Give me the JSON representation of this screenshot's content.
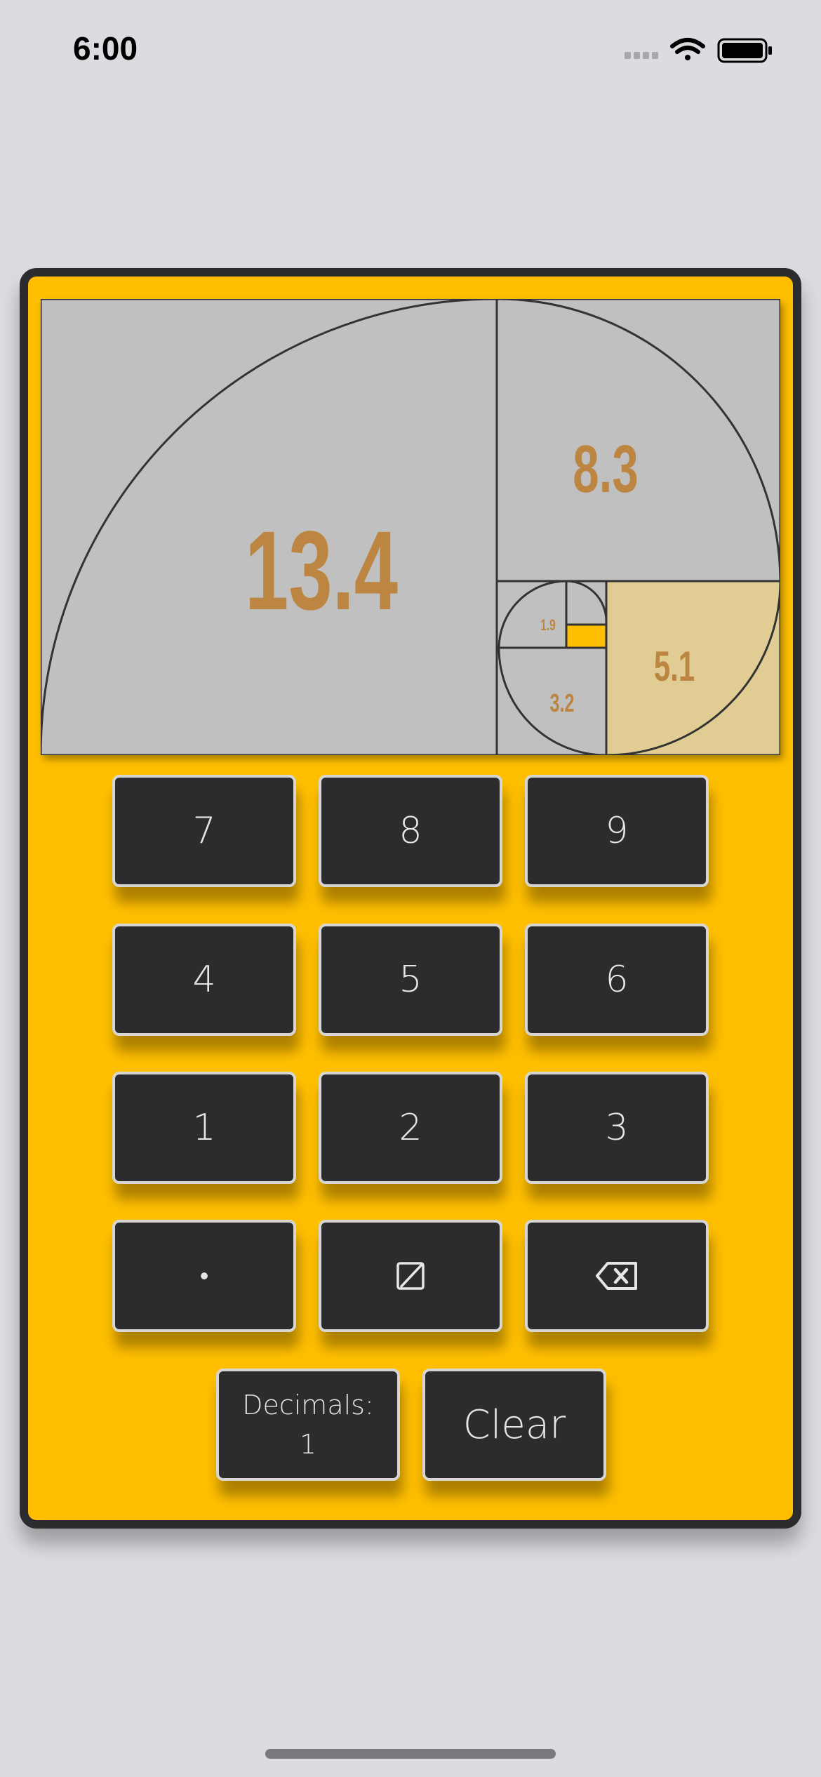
{
  "status_bar": {
    "time": "6:00",
    "icons": [
      "signal-icon",
      "wifi-icon",
      "battery-icon"
    ]
  },
  "display": {
    "values": [
      "13.4",
      "8.3",
      "5.1",
      "3.2",
      "1.9"
    ],
    "colors": {
      "panel": "#c0c0c0",
      "highlight_square": "#e1cd93",
      "smallest_square": "#ffbf00",
      "number": "#bc8642"
    }
  },
  "keypad": {
    "keys": [
      "7",
      "8",
      "9",
      "4",
      "5",
      "6",
      "1",
      "2",
      "3",
      "•"
    ],
    "empty_key_icon": "empty-set-icon",
    "backspace_icon": "backspace-icon",
    "decimals_label": "Decimals:",
    "decimals_value": "1",
    "clear_label": "Clear"
  },
  "colors": {
    "background": "#dcdbdf",
    "device": "#ffbf00",
    "device_border": "#2c2c2e",
    "key": "#2c2c2e",
    "key_border": "#d8d6d2"
  }
}
